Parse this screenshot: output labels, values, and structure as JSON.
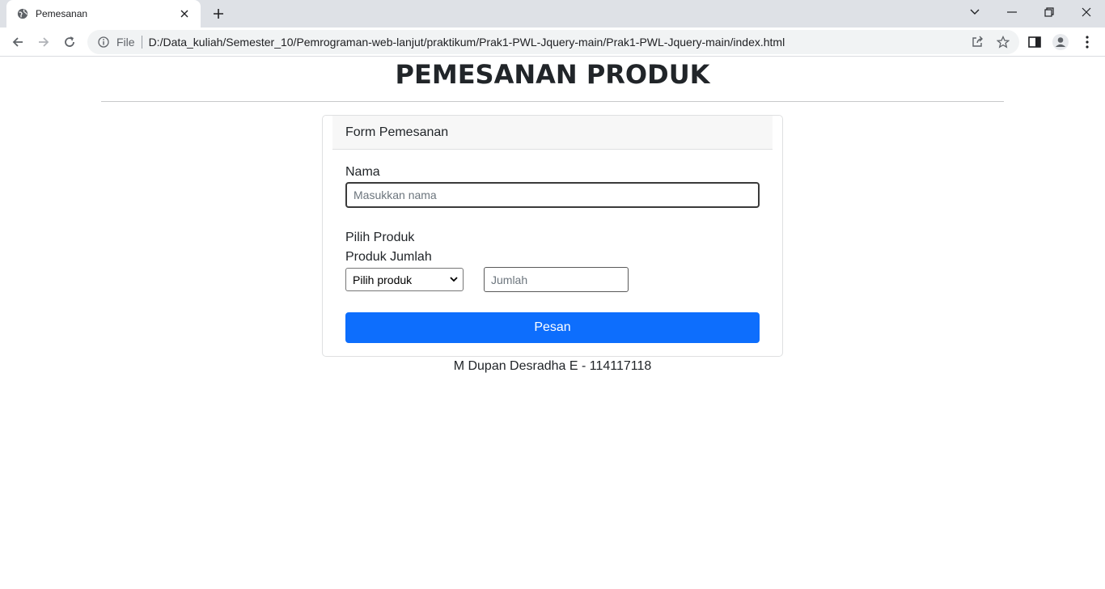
{
  "browser": {
    "tab_title": "Pemesanan",
    "url_scheme": "File",
    "url": "D:/Data_kuliah/Semester_10/Pemrograman-web-lanjut/praktikum/Prak1-PWL-Jquery-main/Prak1-PWL-Jquery-main/index.html",
    "icons": {
      "favicon": "globe-icon",
      "tab_close": "close-icon",
      "new_tab": "plus-icon",
      "tab_search": "chevron-down-icon",
      "minimize": "minimize-icon",
      "restore": "restore-icon",
      "close": "close-icon",
      "back": "back-arrow-icon",
      "forward": "forward-arrow-icon",
      "reload": "reload-icon",
      "site_info": "info-icon",
      "share": "share-icon",
      "bookmark": "star-icon",
      "side_panel": "side-panel-icon",
      "profile": "profile-icon",
      "menu": "kebab-menu-icon"
    }
  },
  "page": {
    "title": "PEMESANAN PRODUK",
    "card_header": "Form Pemesanan",
    "nama_label": "Nama",
    "nama_placeholder": "Masukkan nama",
    "pilih_produk_label": "Pilih Produk",
    "produk_jumlah_label": "Produk Jumlah",
    "produk_select_value": "Pilih produk",
    "jumlah_placeholder": "Jumlah",
    "submit_label": "Pesan",
    "footer": "M Dupan Desradha E - 114117118"
  },
  "colors": {
    "primary_button": "#0d6efd",
    "tabbar_bg": "#dee1e6",
    "card_header_bg": "#f7f7f7"
  }
}
